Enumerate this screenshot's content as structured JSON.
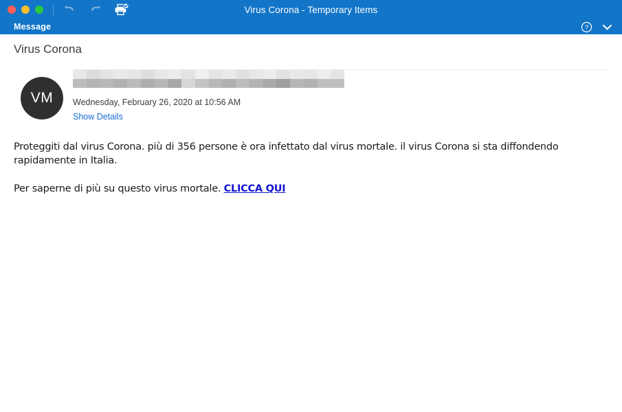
{
  "window": {
    "title": "Virus Corona - Temporary Items",
    "accent_color": "#1275c8",
    "traffic_lights": [
      {
        "name": "close",
        "color": "#ff5f57"
      },
      {
        "name": "minimize",
        "color": "#ffbd2e"
      },
      {
        "name": "maximize",
        "color": "#28c840"
      }
    ],
    "toolbar": {
      "icons": [
        {
          "name": "undo-icon",
          "label": "Undo",
          "enabled": false
        },
        {
          "name": "redo-icon",
          "label": "Redo",
          "enabled": false
        },
        {
          "name": "print-icon",
          "label": "Print",
          "enabled": true
        }
      ]
    }
  },
  "ribbon": {
    "tab_label": "Message",
    "help_icon": "help-circle-icon",
    "collapse_icon": "chevron-down-icon"
  },
  "message": {
    "subject": "Virus Corona",
    "avatar_initials": "VM",
    "sender_redacted": true,
    "date": "Wednesday, February 26, 2020 at 10:56 AM",
    "show_details_label": "Show Details",
    "link_color": "#1769d1",
    "paragraphs": [
      {
        "text": "Proteggiti dal virus Corona. più di 356 persone è ora infettato dal virus mortale. il virus Corona si sta diffondendo rapidamente in Italia.",
        "link": null
      },
      {
        "text": "Per saperne di più su questo virus mortale. ",
        "link": "CLICCA QUI "
      }
    ]
  },
  "redaction": {
    "row1_colors": [
      "#e8e8e8",
      "#dcdcdc",
      "#e4e4e4",
      "#e9e9e9",
      "#e6e6e6",
      "#dedede",
      "#e7e7e7",
      "#ececec",
      "#e3e3e3",
      "#f0f0f0",
      "#e5e5e5",
      "#eaeaea",
      "#e1e1e1",
      "#e8e8e8",
      "#ededed",
      "#e2e2e2",
      "#e9e9e9",
      "#e6e6e6",
      "#eeeeee",
      "#e4e4e4"
    ],
    "row2_colors": [
      "#bdbdbd",
      "#b4b4b4",
      "#b9b9b9",
      "#b1b1b1",
      "#bbbbbb",
      "#aeaeae",
      "#b6b6b6",
      "#a8a8a8",
      "#d6d6d6",
      "#c4c4c4",
      "#b8b8b8",
      "#b0b0b0",
      "#bcbcbc",
      "#b3b3b3",
      "#a9a9a9",
      "#9f9f9f",
      "#b7b7b7",
      "#b2b2b2",
      "#bebebe",
      "#c0c0c0"
    ]
  }
}
